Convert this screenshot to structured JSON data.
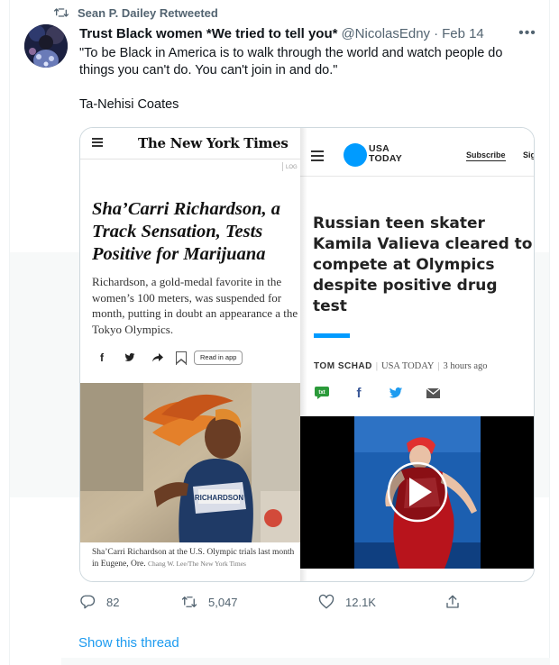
{
  "retweet": {
    "label": "Sean P. Dailey Retweeted",
    "icon": "retweet-icon"
  },
  "author": {
    "name": "Trust Black women *We tried to tell you*",
    "handle": "@NicolasEdny",
    "separator": "·",
    "date": "Feb 14"
  },
  "more_icon": "ellipsis-icon",
  "tweet": {
    "text": "\"To be Black in America is to walk through the world and watch people do things you can't do. You can't join in and do.\"",
    "attribution": "Ta-Nehisi Coates"
  },
  "nyt": {
    "logo": "The New York Times",
    "log": "LOG",
    "headline": "Sha’Carri Richardson, a Track Sensation, Tests Positive for Marijuana",
    "summary": "Richardson, a gold-medal favorite in the women’s 100 meters, was suspended for month, putting in doubt an appearance a the Tokyo Olympics.",
    "share": {
      "facebook": "f",
      "twitter_icon": "twitter-bird-icon",
      "forward_icon": "share-arrow-icon",
      "bookmark_icon": "bookmark-icon",
      "read_in_app": "Read in app"
    },
    "photo_bib": "RICHARDSON",
    "caption": "Sha’Carri Richardson at the U.S. Olympic trials last month in Eugene, Ore.",
    "credit": "Chang W. Lee/The New York Times"
  },
  "usatoday": {
    "logo_line1": "USA",
    "logo_line2": "TODAY",
    "subscribe": "Subscribe",
    "sign_in_partial": "Sig",
    "headline": "Russian teen skater Kamila Valieva cleared to compete at Olympics despite positive drug test",
    "byline_author": "TOM SCHAD",
    "byline_outlet": "USA TODAY",
    "byline_time": "3 hours ago",
    "share": {
      "text": "txt",
      "facebook": "f",
      "twitter_icon": "twitter-bird-icon",
      "email_icon": "email-icon"
    },
    "video_icon": "play-icon"
  },
  "actions": {
    "reply": "82",
    "retweet": "5,047",
    "like": "12.1K",
    "share_icon": "share-icon"
  },
  "show_thread": "Show this thread",
  "colors": {
    "link": "#1d9bf0",
    "muted": "#536471",
    "usat_blue": "#009bff",
    "text": "#0f1419"
  }
}
